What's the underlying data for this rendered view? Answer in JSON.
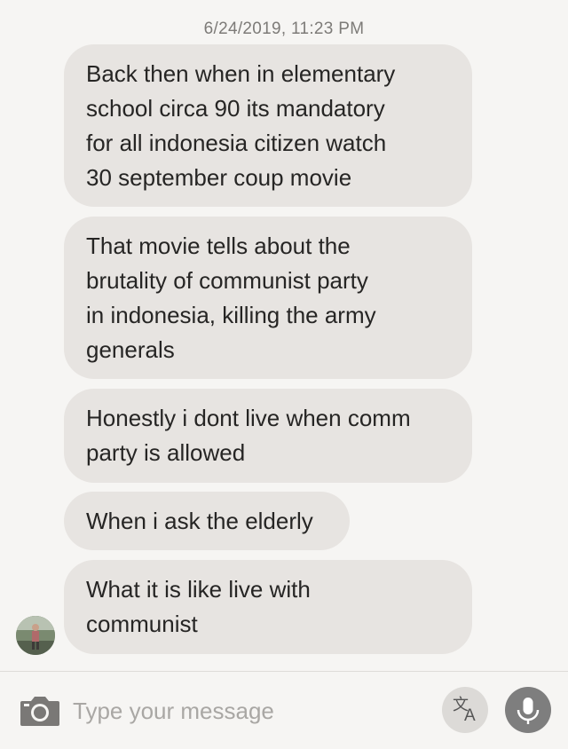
{
  "header": {
    "timestamp": "6/24/2019, 11:23 PM"
  },
  "messages": [
    {
      "text": "Back then when in elementary\nschool circa 90 its mandatory\nfor all indonesia citizen watch\n30 september coup  movie"
    },
    {
      "text": "That movie tells about the\nbrutality of communist party\nin indonesia, killing the army\ngenerals"
    },
    {
      "text": "Honestly i dont live when comm\nparty is allowed"
    },
    {
      "text": "When i ask the elderly"
    },
    {
      "text": "What it is like live with\ncommunist"
    }
  ],
  "composer": {
    "placeholder": "Type your message",
    "camera_icon": "camera-icon",
    "translate_icon": "translate-icon",
    "mic_icon": "microphone-icon"
  },
  "colors": {
    "background": "#f6f5f3",
    "bubble": "#e7e4e1",
    "text": "#262524",
    "mic_button": "#7e7e7e"
  }
}
